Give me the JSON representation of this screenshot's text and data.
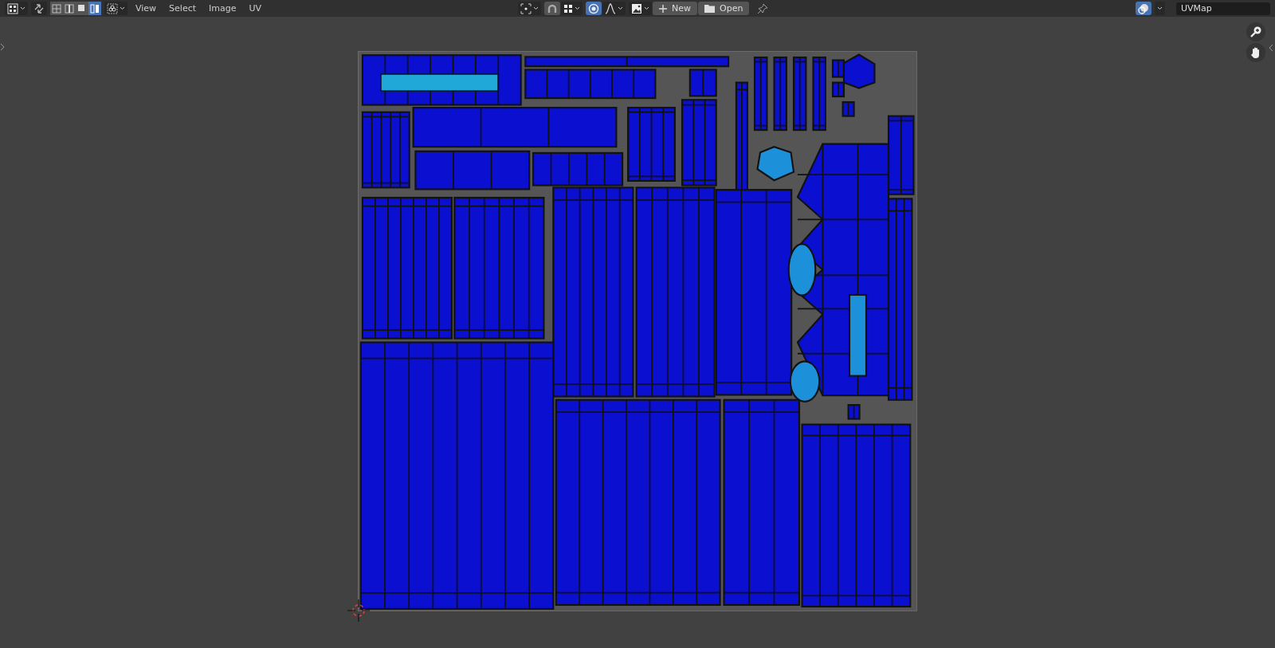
{
  "header": {
    "sync_selection": {
      "on": false
    },
    "select_modes": [
      {
        "selected": false
      },
      {
        "selected": false
      },
      {
        "selected": false
      },
      {
        "selected": true
      }
    ],
    "menus": [
      "View",
      "Select",
      "Image",
      "UV"
    ],
    "snapping": {
      "on": false
    },
    "proportional_editing": {
      "on": true
    },
    "buttons": [
      {
        "kind": "new",
        "label": "New"
      },
      {
        "kind": "open",
        "label": "Open"
      }
    ],
    "overlays": {
      "on": true
    },
    "uv_map": {
      "value": "UVMap"
    }
  }
}
